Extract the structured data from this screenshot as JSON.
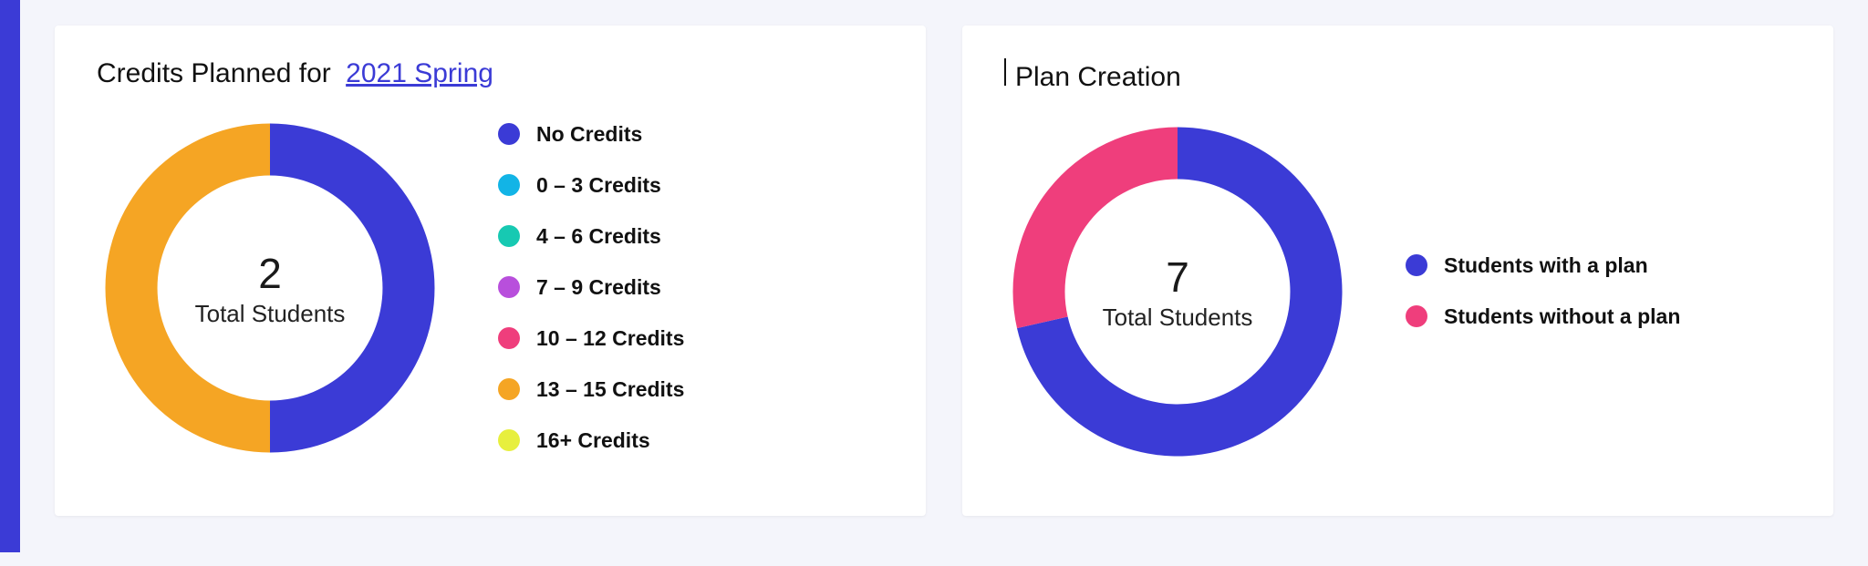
{
  "credits_card": {
    "title_prefix": "Credits Planned for ",
    "term_link": "2021 Spring",
    "center_value": "2",
    "center_label": "Total Students",
    "legend": [
      {
        "label": "No Credits",
        "color": "#3b3bd6"
      },
      {
        "label": "0 – 3 Credits",
        "color": "#12b4e6"
      },
      {
        "label": "4 – 6 Credits",
        "color": "#17c9b2"
      },
      {
        "label": "7 – 9 Credits",
        "color": "#b84fdc"
      },
      {
        "label": "10 – 12 Credits",
        "color": "#ef3e7c"
      },
      {
        "label": "13 – 15 Credits",
        "color": "#f5a524"
      },
      {
        "label": "16+ Credits",
        "color": "#e7ef3e"
      }
    ]
  },
  "plan_card": {
    "title": "Plan Creation",
    "center_value": "7",
    "center_label": "Total Students",
    "legend": [
      {
        "label": "Students with a plan",
        "color": "#3b3bd6"
      },
      {
        "label": "Students without a plan",
        "color": "#ef3e7c"
      }
    ]
  },
  "chart_data": [
    {
      "type": "pie",
      "title": "Credits Planned for 2021 Spring",
      "total_label": "Total Students",
      "total_value": 2,
      "categories": [
        "No Credits",
        "0 – 3 Credits",
        "4 – 6 Credits",
        "7 – 9 Credits",
        "10 – 12 Credits",
        "13 – 15 Credits",
        "16+ Credits"
      ],
      "values": [
        1,
        0,
        0,
        0,
        0,
        1,
        0
      ],
      "colors": [
        "#3b3bd6",
        "#12b4e6",
        "#17c9b2",
        "#b84fdc",
        "#ef3e7c",
        "#f5a524",
        "#e7ef3e"
      ]
    },
    {
      "type": "pie",
      "title": "Plan Creation",
      "total_label": "Total Students",
      "total_value": 7,
      "categories": [
        "Students with a plan",
        "Students without a plan"
      ],
      "values": [
        5,
        2
      ],
      "colors": [
        "#3b3bd6",
        "#ef3e7c"
      ]
    }
  ]
}
